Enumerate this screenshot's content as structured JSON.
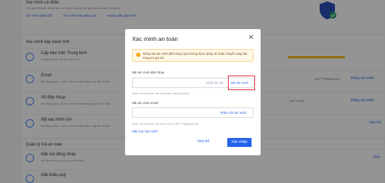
{
  "page": {
    "top": {
      "title": "Xác minh cá nhân",
      "desc": "Chúng tôi khuyến khích bạn xác minh cá nhân để đảm bảo an toàn tài khoản",
      "links": [
        "Xác minh danh tính",
        "Xác minh Fiat nâng cao",
        "Hướng dẫn quy trình"
      ]
    },
    "two_fa": {
      "title": "Xác minh kép danh tính",
      "rows": [
        {
          "title": "Cấp bảo mật: Trung bình",
          "desc": "Khuyến khích mở xác minh GA",
          "value": "",
          "link": ""
        },
        {
          "title": "Email",
          "desc": "Để đăng nhập, rút tiền, tìm lại mật khẩu, thay đổi cài đặt",
          "value": "nat*****@gmail.com",
          "link": "Đóng xác minh"
        },
        {
          "title": "Số điện thoại",
          "desc": "Để đăng nhập, rút tiền, tìm lại mật khẩu, thay đổi cài đặt",
          "value": "135****2062",
          "link": "Đóng xác minh"
        },
        {
          "title": "Mã xác minh GA",
          "desc": "Để đăng nhập, rút tiền, tìm lại mật khẩu, thay đổi cài đặt",
          "value": "",
          "link": "Liên kết"
        }
      ]
    },
    "security": {
      "title": "Quản lý mã an toàn",
      "rows": [
        {
          "title": "Mật mã đăng nhập",
          "desc": "Để đảm bảo an toàn cho tài khoản",
          "link": "Sửa"
        },
        {
          "title": "Mật khẩu quỹ",
          "desc": "",
          "link": ""
        }
      ]
    }
  },
  "modal": {
    "title": "Xác minh an toàn",
    "close_icon": "close-icon",
    "warning_icon": "warning-icon",
    "warning": "Đóng mã xác minh điện thoại, bạn không được phép rút hoặc chuyển sang fiat trong 24 giờ tới.",
    "phone": {
      "label": "Mã xác minh điện thoại",
      "resend_label": "Nhận lại mã",
      "get_code_label": "Mã xác minh",
      "placeholder": "",
      "hint": "Nhận và nhập mã xác minh điện thoại (phone)"
    },
    "email": {
      "label": "Mã xác minh email",
      "get_code_label": "Nhận mã xác minh",
      "placeholder": "",
      "hint": "Nhận và nhập mã xác minh email nat*****@gmail.com"
    },
    "lost_code_label": "Mất mục bảo mật?",
    "cancel_label": "Huỷ bỏ",
    "confirm_label": "Xác nhận"
  },
  "colors": {
    "accent": "#2563eb",
    "warning": "#f59e0b",
    "highlight": "#e11d2e"
  }
}
